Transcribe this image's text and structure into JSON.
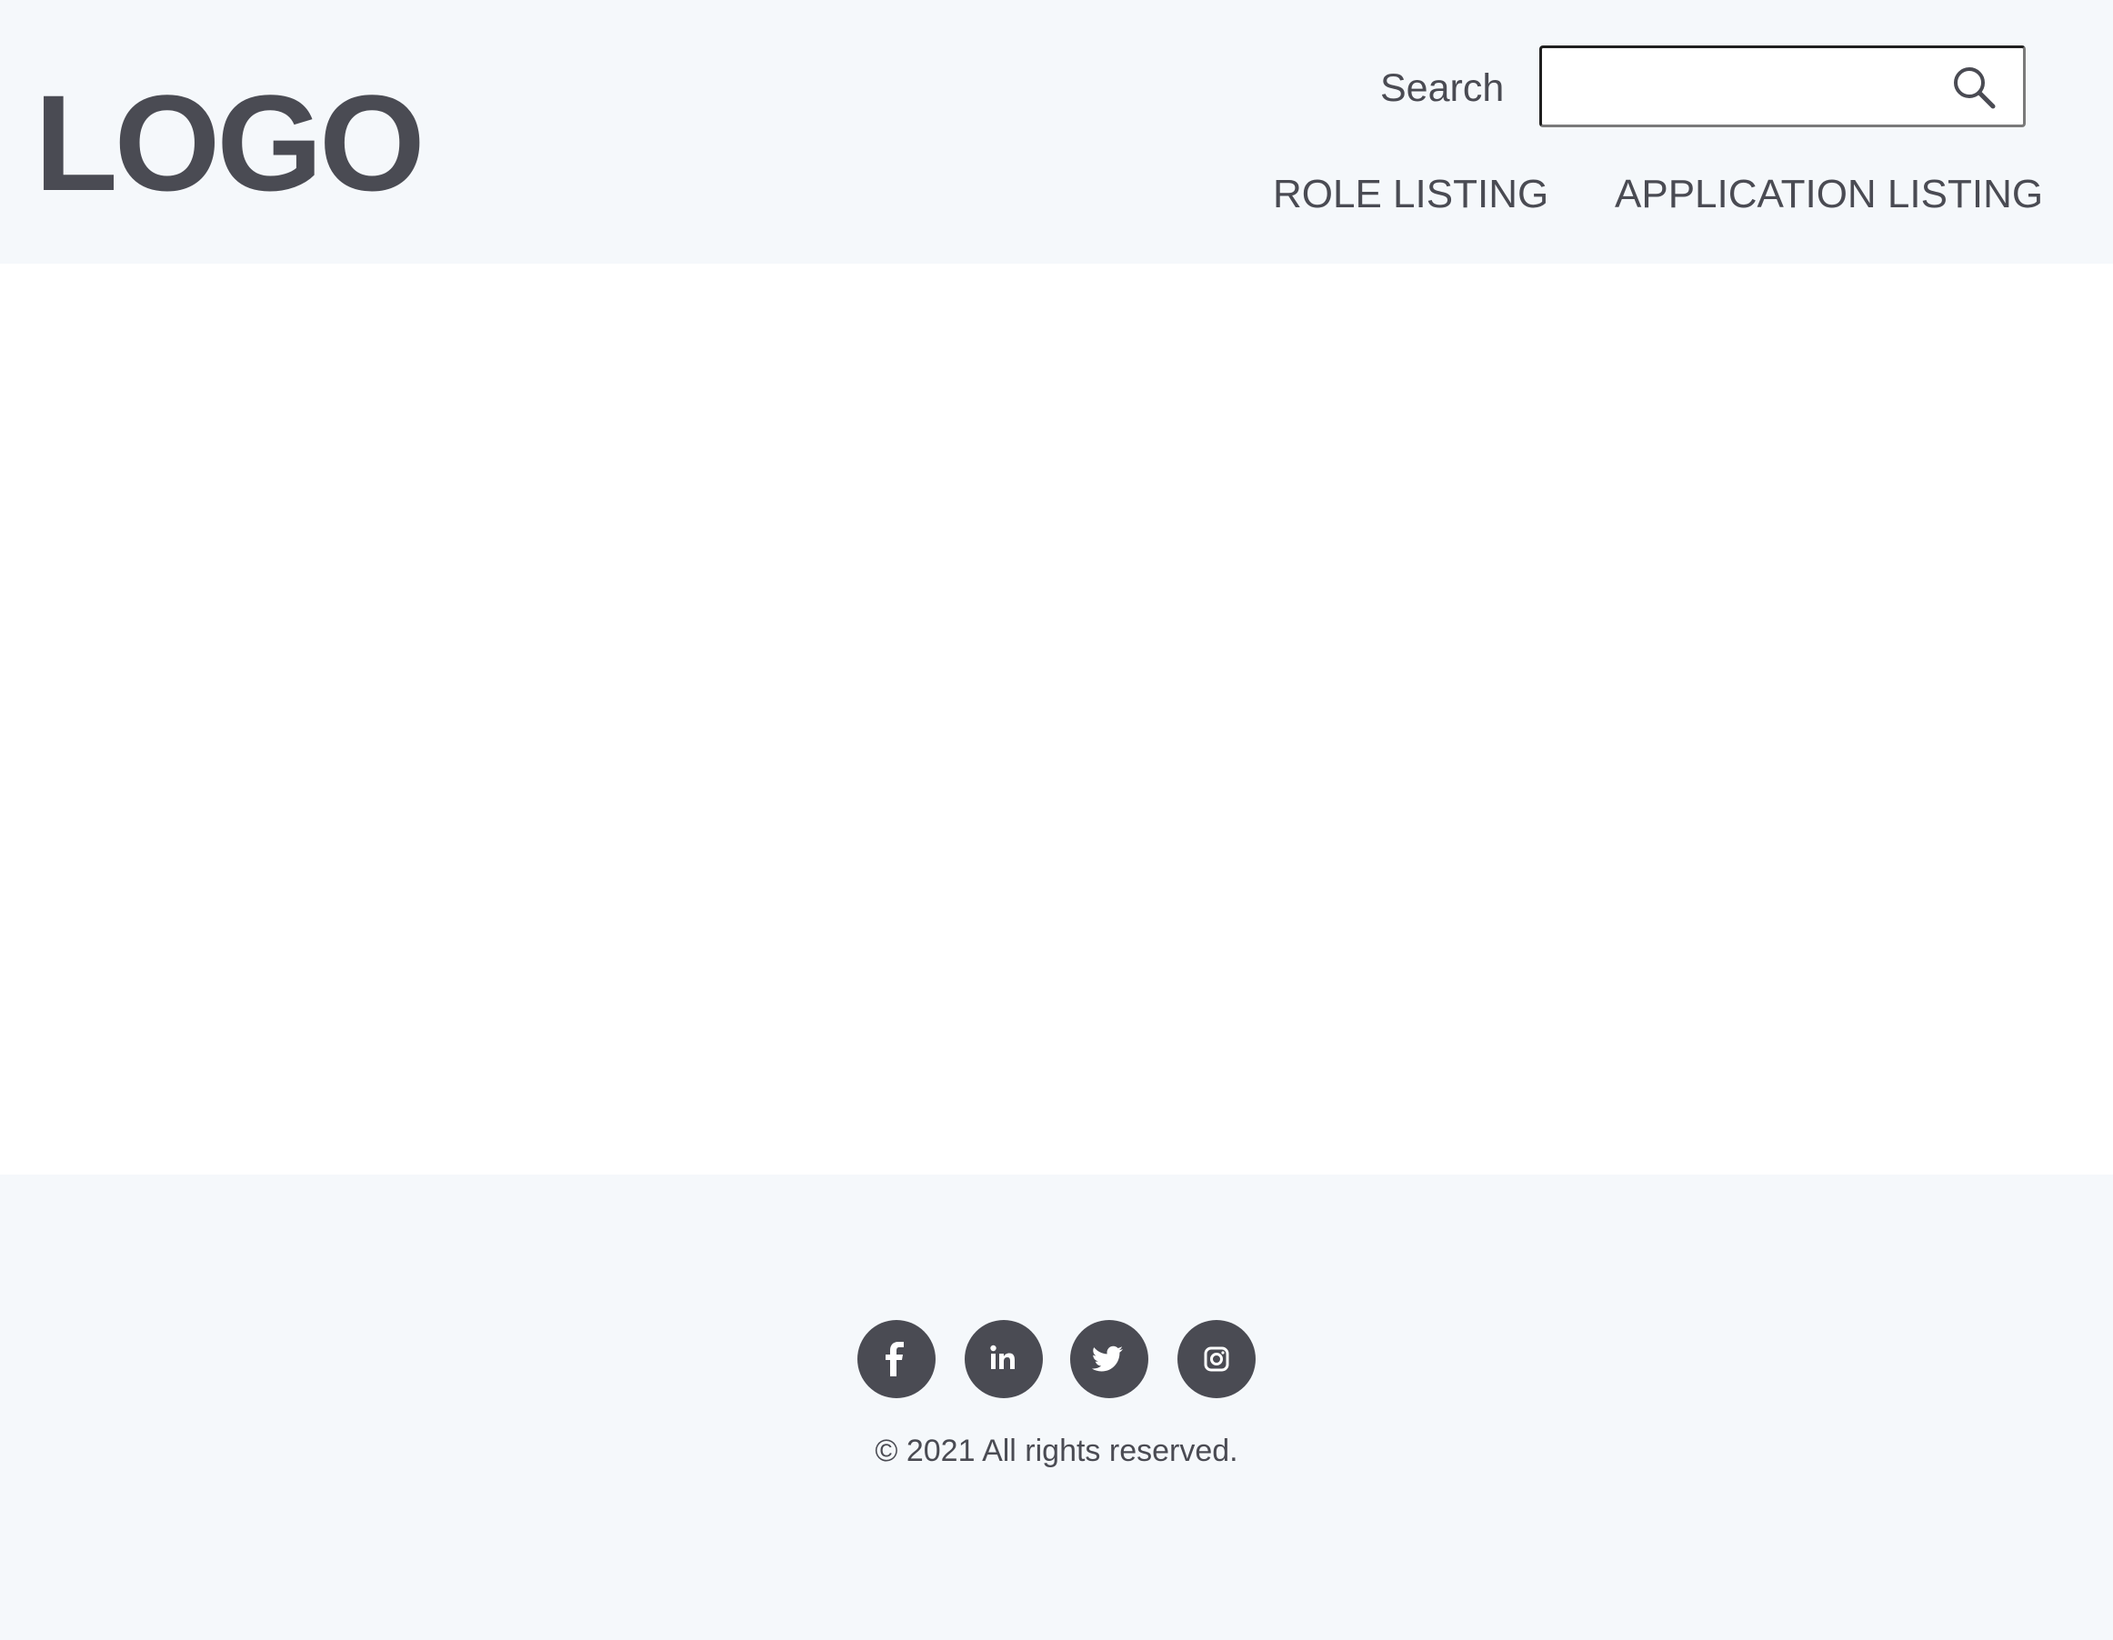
{
  "header": {
    "logo_text": "LOGO",
    "search": {
      "label": "Search",
      "value": "",
      "placeholder": ""
    },
    "nav": {
      "role_listing": "ROLE LISTING",
      "application_listing": "APPLICATION LISTING"
    }
  },
  "footer": {
    "social_icons": [
      "facebook-icon",
      "linkedin-icon",
      "twitter-icon",
      "instagram-icon"
    ],
    "copyright": "© 2021 All rights reserved."
  },
  "colors": {
    "header_bg": "#f5f8fb",
    "footer_bg": "#f5f8fb",
    "text": "#4a4b53",
    "icon_circle": "#4a4b53"
  }
}
